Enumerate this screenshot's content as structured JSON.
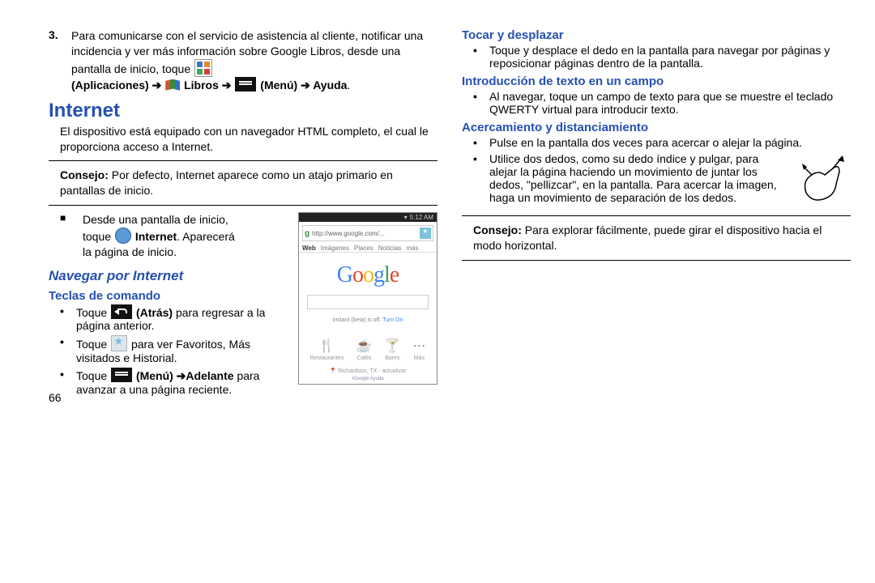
{
  "left": {
    "step_num": "3.",
    "step_text_a": "Para comunicarse con el servicio de asistencia al cliente, notificar una incidencia y ver más información sobre Google Libros, desde una pantalla de inicio, toque ",
    "step_apps": "(Aplicaciones)",
    "step_libros": "Libros",
    "step_menu": "(Menú)",
    "step_ayuda": "Ayuda",
    "arrow": " ➔ ",
    "h1": "Internet",
    "intro": "El dispositivo está equipado con un navegador HTML completo, el cual le proporciona acceso a Internet.",
    "tip_label": "Consejo:",
    "tip_text": "Por defecto, Internet aparece como un atajo primario en pantallas de inicio.",
    "start_a": "Desde una pantalla de inicio, toque ",
    "start_bold": "Internet",
    "start_b": ". Aparecerá la página de inicio.",
    "h2": "Navegar por Internet",
    "h3a": "Teclas de comando",
    "cmd1a": "Toque ",
    "cmd1b": "(Atrás)",
    "cmd1c": " para regresar a la página anterior.",
    "cmd2a": "Toque ",
    "cmd2b": " para ver Favoritos, Más visitados e Historial.",
    "cmd3a": "Toque ",
    "cmd3b": "(Menú) ➔Adelante",
    "cmd3c": " para avanzar a una página reciente.",
    "pagenum": "66"
  },
  "phone": {
    "time": "5:12 AM",
    "url": "http://www.google.com/...",
    "tabs": [
      "Web",
      "Imágenes",
      "Places",
      "Noticias",
      "más"
    ],
    "google": [
      "G",
      "o",
      "o",
      "g",
      "l",
      "e"
    ],
    "instant_a": "Instant (beta) is off.",
    "instant_b": "Turn On",
    "cats": [
      {
        "ic": "🍴",
        "label": "Restaurantes"
      },
      {
        "ic": "☕",
        "label": "Cafés"
      },
      {
        "ic": "🍸",
        "label": "Bares"
      },
      {
        "ic": "⋯",
        "label": "Más"
      }
    ],
    "loc": "Richardson, TX - actualizar",
    "map": "iGoogle Ayuda"
  },
  "right": {
    "h3b": "Tocar y desplazar",
    "touch": "Toque y desplace el dedo en la pantalla para navegar por páginas y reposicionar páginas dentro de la pantalla.",
    "h3c": "Introducción de texto en un campo",
    "text_entry": "Al navegar, toque un campo de texto para que se muestre el teclado QWERTY virtual para introducir texto.",
    "h3d": "Acercamiento y distanciamiento",
    "zoom1": "Pulse en la pantalla dos veces para acercar o alejar la página.",
    "zoom2": "Utilice dos dedos, como su dedo índice y pulgar, para alejar la página haciendo un movimiento de juntar los dedos, \"pellizcar\", en la pantalla. Para acercar la imagen, haga un movimiento de separación de los dedos.",
    "tip2_label": "Consejo:",
    "tip2_text": "Para explorar fácilmente, puede girar el dispositivo hacia el modo horizontal."
  }
}
